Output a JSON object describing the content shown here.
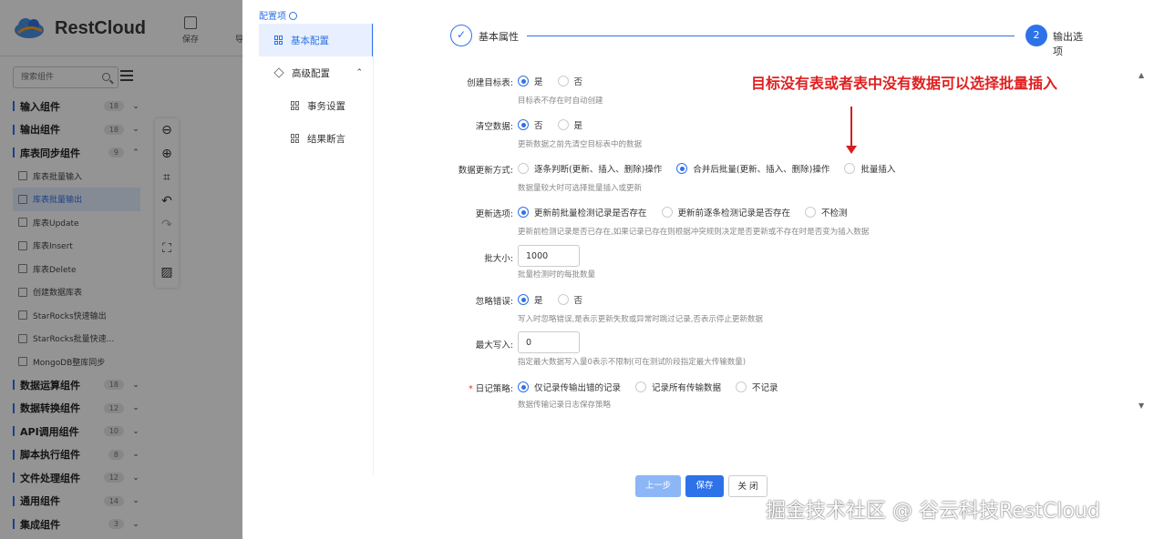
{
  "app": {
    "logo_text": "RestCloud",
    "toolbar": {
      "save_label": "保存",
      "more_label": "导"
    },
    "search": {
      "placeholder": "搜索组件",
      "value": ""
    },
    "nav": [
      {
        "label": "输入组件",
        "count": "18",
        "expanded": false
      },
      {
        "label": "输出组件",
        "count": "18",
        "expanded": false
      },
      {
        "label": "库表同步组件",
        "count": "9",
        "expanded": true,
        "items": [
          {
            "label": "库表批量输入",
            "active": false
          },
          {
            "label": "库表批量输出",
            "active": true
          },
          {
            "label": "库表Update",
            "active": false
          },
          {
            "label": "库表Insert",
            "active": false
          },
          {
            "label": "库表Delete",
            "active": false
          },
          {
            "label": "创建数据库表",
            "active": false
          },
          {
            "label": "StarRocks快速输出",
            "active": false
          },
          {
            "label": "StarRocks批量快速...",
            "active": false
          },
          {
            "label": "MongoDB整库同步",
            "active": false
          }
        ]
      },
      {
        "label": "数据运算组件",
        "count": "18",
        "expanded": false
      },
      {
        "label": "数据转换组件",
        "count": "12",
        "expanded": false
      },
      {
        "label": "API调用组件",
        "count": "10",
        "expanded": false
      },
      {
        "label": "脚本执行组件",
        "count": "8",
        "expanded": false
      },
      {
        "label": "文件处理组件",
        "count": "12",
        "expanded": false
      },
      {
        "label": "通用组件",
        "count": "14",
        "expanded": false
      },
      {
        "label": "集成组件",
        "count": "3",
        "expanded": false
      }
    ],
    "canvas_tools": [
      "zoom-out-icon",
      "zoom-in-icon",
      "fit-icon",
      "undo-icon",
      "redo-icon",
      "fullscreen-icon",
      "grid-icon"
    ]
  },
  "drawer": {
    "config_title": "配置项",
    "menu": {
      "basic": "基本配置",
      "advanced": "高级配置",
      "transaction": "事务设置",
      "assertion": "结果断言"
    },
    "steps": [
      {
        "label": "基本属性",
        "state": "done"
      },
      {
        "label": "输出选项",
        "number": "2",
        "state": "active"
      }
    ],
    "form": {
      "create_table": {
        "label": "创建目标表:",
        "options": [
          "是",
          "否"
        ],
        "selected": 0,
        "help": "目标表不存在时自动创建"
      },
      "clear_data": {
        "label": "清空数据:",
        "options": [
          "否",
          "是"
        ],
        "selected": 0,
        "help": "更新数据之前先清空目标表中的数据"
      },
      "update_mode": {
        "label": "数据更新方式:",
        "options": [
          "逐条判断(更新、插入、删除)操作",
          "合并后批量(更新、插入、删除)操作",
          "批量插入"
        ],
        "selected": 1,
        "help": "数据量较大时可选择批量插入或更新"
      },
      "update_option": {
        "label": "更新选项:",
        "options": [
          "更新前批量检测记录是否存在",
          "更新前逐条检测记录是否存在",
          "不检测"
        ],
        "selected": 0,
        "help": "更新前检测记录是否已存在,如果记录已存在则根据冲突规则决定是否更新或不存在时是否变为插入数据"
      },
      "batch_size": {
        "label": "批大小:",
        "value": "1000",
        "help": "批量检测时的每批数量"
      },
      "ignore_error": {
        "label": "忽略错误:",
        "options": [
          "是",
          "否"
        ],
        "selected": 0,
        "help": "写入时忽略错误,是表示更新失败或异常时跳过记录,否表示停止更新数据"
      },
      "max_write": {
        "label": "最大写入:",
        "value": "0",
        "help": "指定最大数据写入量0表示不限制(可在测试阶段指定最大传输数量)"
      },
      "log_policy": {
        "label": "日记策略:",
        "required": true,
        "options": [
          "仅记录传输出错的记录",
          "记录所有传输数据",
          "不记录"
        ],
        "selected": 0,
        "help": "数据传输记录日志保存策略"
      }
    },
    "buttons": {
      "prev": "上一步",
      "save": "保存",
      "close": "关 闭"
    }
  },
  "annotation": "目标没有表或者表中没有数据可以选择批量插入",
  "watermark": "掘金技术社区 @ 谷云科技RestCloud",
  "colors": {
    "primary": "#2d72e8",
    "annotation": "#e02020",
    "overlay": "rgba(0,0,0,0.42)"
  }
}
